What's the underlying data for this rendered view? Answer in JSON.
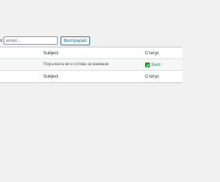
{
  "filter": {
    "label_fragment": "x",
    "email_placeholder": "email...",
    "email_value": "",
    "button_label": "Филтрирай"
  },
  "table": {
    "header": {
      "subject": "Subject",
      "status": "Статус"
    },
    "rows": [
      {
        "subject": "Поръчката ви е готова за вземане",
        "status": "Sent"
      }
    ],
    "footer": {
      "subject": "Subject",
      "status": "Статус"
    }
  },
  "colors": {
    "accent": "#2271b1",
    "sent": "#00a32a",
    "background": "#f1f1f1"
  },
  "icons": {
    "status_sent": "check-icon"
  }
}
